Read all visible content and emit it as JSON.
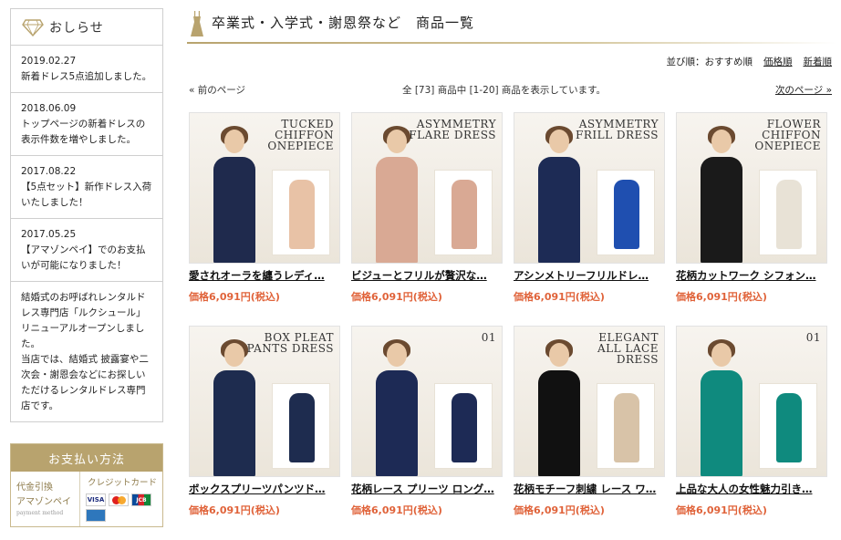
{
  "sidebar": {
    "news_title": "おしらせ",
    "news": [
      {
        "date": "2019.02.27",
        "text": "新着ドレス5点追加しました。"
      },
      {
        "date": "2018.06.09",
        "text": "トップページの新着ドレスの\n表示件数を増やしました。"
      },
      {
        "date": "2017.08.22",
        "text": "【5点セット】新作ドレス入荷\nいたしました！"
      },
      {
        "date": "2017.05.25",
        "text": "【アマゾンペイ】でのお支払\nいが可能になりました！"
      },
      {
        "date": "",
        "text": "結婚式のお呼ばれレンタルド\nレス専門店「ルクシュール」\nリニューアルオープンしまし\nた。\n当店では、結婚式 披露宴や二\n次会・謝恩会などにお探しい\nただけるレンタルドレス専門\n店です。"
      }
    ],
    "payment": {
      "title": "お支払い方法",
      "left_line1": "代金引換",
      "left_line2": "アマゾンペイ",
      "left_sub": "payment method",
      "credit_label": "クレジットカード",
      "cards": [
        "VISA",
        "MC",
        "JCB"
      ]
    }
  },
  "main": {
    "title": "卒業式・入学式・謝恩祭など　商品一覧",
    "sort": {
      "label": "並び順：",
      "current": "おすすめ順",
      "price": "価格順",
      "newest": "新着順"
    },
    "pager": {
      "prev": "« 前のページ",
      "count": "全 [73] 商品中 [1-20] 商品を表示しています。",
      "next": "次のページ »"
    },
    "products": [
      {
        "name": "愛されオーラを纏うレディ…",
        "price": "価格6,091円(税込)",
        "headline": "TUCKED\nCHIFFON\nONEPIECE",
        "color": "#1f2a4d",
        "inset": "#e8c2a6"
      },
      {
        "name": "ビジューとフリルが贅沢な…",
        "price": "価格6,091円(税込)",
        "headline": "ASYMMETRY\nFLARE DRESS",
        "color": "#d9a994",
        "inset": "#d9a994"
      },
      {
        "name": "アシンメトリーフリルドレ…",
        "price": "価格6,091円(税込)",
        "headline": "ASYMMETRY\nFRILL DRESS",
        "color": "#1d2b55",
        "inset": "#1f4fb0"
      },
      {
        "name": "花柄カットワーク シフォン…",
        "price": "価格6,091円(税込)",
        "headline": "FLOWER\nCHIFFON\nONEPIECE",
        "color": "#1a1a1a",
        "inset": "#e8e2d6"
      },
      {
        "name": "ボックスプリーツパンツド…",
        "price": "価格6,091円(税込)",
        "headline": "BOX PLEAT\nPANTS DRESS",
        "color": "#1e2c4f",
        "inset": "#1e2c4f"
      },
      {
        "name": "花柄レース プリーツ ロング…",
        "price": "価格6,091円(税込)",
        "headline": "01",
        "color": "#1d2a55",
        "inset": "#1d2a55"
      },
      {
        "name": "花柄モチーフ刺繍 レース ワ…",
        "price": "価格6,091円(税込)",
        "headline": "ELEGANT\nALL LACE\nDRESS",
        "color": "#111111",
        "inset": "#d8c3a8"
      },
      {
        "name": "上品な大人の女性魅力引き…",
        "price": "価格6,091円(税込)",
        "headline": "01",
        "color": "#0f8a7e",
        "inset": "#0f8a7e"
      }
    ]
  }
}
